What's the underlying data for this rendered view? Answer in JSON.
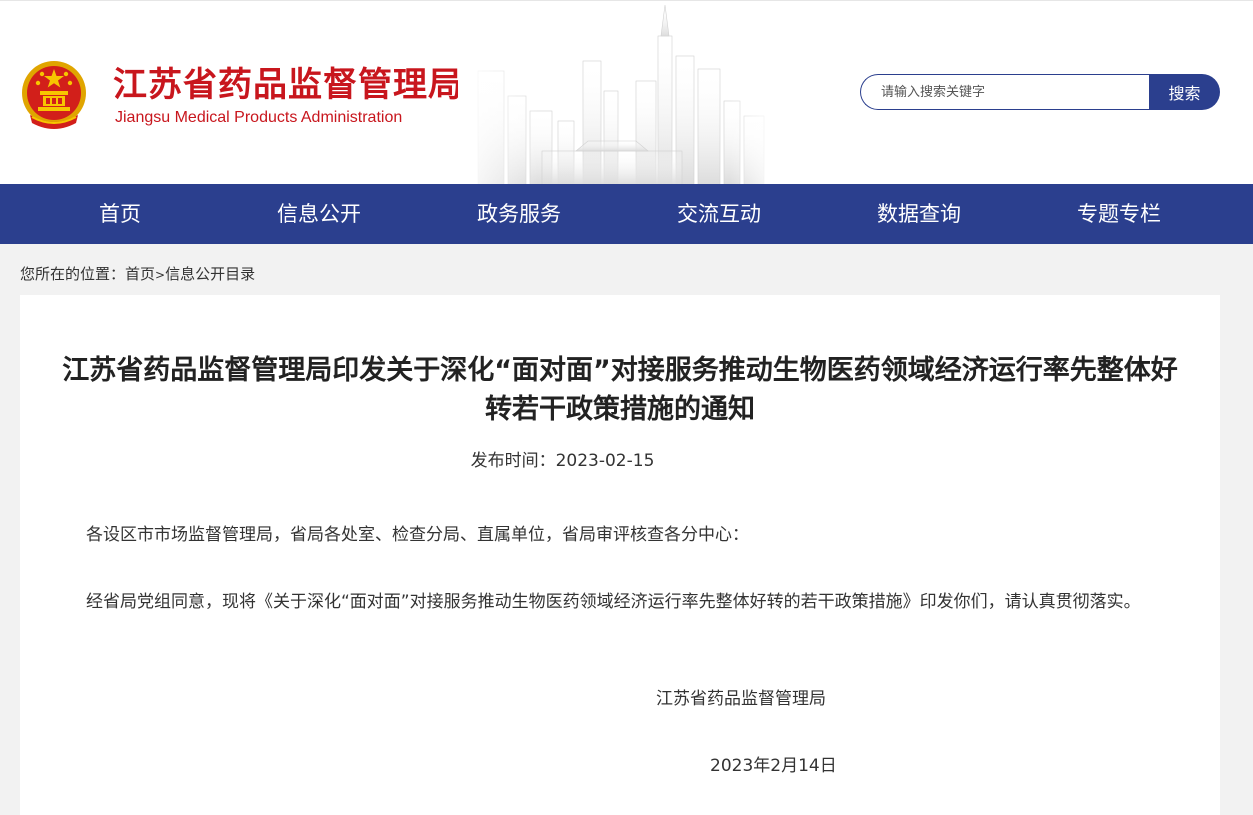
{
  "header": {
    "title_cn": "江苏省药品监督管理局",
    "title_en": "Jiangsu Medical Products Administration",
    "search_placeholder": "请输入搜索关键字",
    "search_button": "搜索"
  },
  "nav": {
    "items": [
      {
        "label": "首页"
      },
      {
        "label": "信息公开"
      },
      {
        "label": "政务服务"
      },
      {
        "label": "交流互动"
      },
      {
        "label": "数据查询"
      },
      {
        "label": "专题专栏"
      }
    ]
  },
  "breadcrumb": {
    "prefix": "您所在的位置：",
    "home": "首页",
    "separator": ">",
    "current": "信息公开目录"
  },
  "article": {
    "title": "江苏省药品监督管理局印发关于深化“面对面”对接服务推动生物医药领域经济运行率先整体好转若干政策措施的通知",
    "date_label": "发布时间：",
    "date": "2023-02-15",
    "paragraphs": [
      "各设区市市场监督管理局，省局各处室、检查分局、直属单位，省局审评核查各分中心：",
      "经省局党组同意，现将《关于深化“面对面”对接服务推动生物医药领域经济运行率先整体好转的若干政策措施》印发你们，请认真贯彻落实。"
    ],
    "signature_org": "江苏省药品监督管理局",
    "signature_date": "2023年2月14日"
  },
  "colors": {
    "brand_red": "#c8161d",
    "nav_blue": "#2b3f8e",
    "page_bg": "#f2f2f2"
  },
  "icons": {
    "emblem": "national-emblem-icon",
    "skyline": "city-skyline-illustration"
  }
}
